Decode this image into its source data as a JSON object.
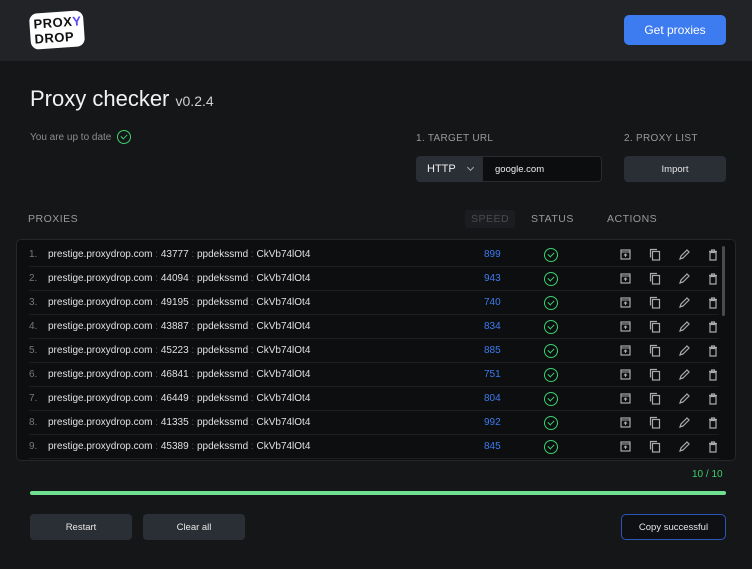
{
  "header": {
    "logo": "PROXY DROP",
    "get_proxies": "Get proxies"
  },
  "page": {
    "title": "Proxy checker",
    "version": "v0.2.4",
    "status": "You are up to date"
  },
  "target": {
    "label": "1. TARGET URL",
    "protocol": "HTTP",
    "url": "google.com"
  },
  "proxy_list": {
    "label": "2. PROXY LIST",
    "import": "Import"
  },
  "columns": {
    "proxies": "PROXIES",
    "speed": "SPEED",
    "status": "STATUS",
    "actions": "ACTIONS"
  },
  "rows": [
    {
      "n": "1.",
      "host": "prestige.proxydrop.com",
      "port": "43777",
      "user": "ppdekssmd",
      "pass": "CkVb74lOt4",
      "speed": "899",
      "ok": true
    },
    {
      "n": "2.",
      "host": "prestige.proxydrop.com",
      "port": "44094",
      "user": "ppdekssmd",
      "pass": "CkVb74lOt4",
      "speed": "943",
      "ok": true
    },
    {
      "n": "3.",
      "host": "prestige.proxydrop.com",
      "port": "49195",
      "user": "ppdekssmd",
      "pass": "CkVb74lOt4",
      "speed": "740",
      "ok": true
    },
    {
      "n": "4.",
      "host": "prestige.proxydrop.com",
      "port": "43887",
      "user": "ppdekssmd",
      "pass": "CkVb74lOt4",
      "speed": "834",
      "ok": true
    },
    {
      "n": "5.",
      "host": "prestige.proxydrop.com",
      "port": "45223",
      "user": "ppdekssmd",
      "pass": "CkVb74lOt4",
      "speed": "885",
      "ok": true
    },
    {
      "n": "6.",
      "host": "prestige.proxydrop.com",
      "port": "46841",
      "user": "ppdekssmd",
      "pass": "CkVb74lOt4",
      "speed": "751",
      "ok": true
    },
    {
      "n": "7.",
      "host": "prestige.proxydrop.com",
      "port": "46449",
      "user": "ppdekssmd",
      "pass": "CkVb74lOt4",
      "speed": "804",
      "ok": true
    },
    {
      "n": "8.",
      "host": "prestige.proxydrop.com",
      "port": "41335",
      "user": "ppdekssmd",
      "pass": "CkVb74lOt4",
      "speed": "992",
      "ok": true
    },
    {
      "n": "9.",
      "host": "prestige.proxydrop.com",
      "port": "45389",
      "user": "ppdekssmd",
      "pass": "CkVb74lOt4",
      "speed": "845",
      "ok": true
    }
  ],
  "progress": {
    "text": "10 / 10",
    "fraction": 1.0
  },
  "footer": {
    "restart": "Restart",
    "clear": "Clear all",
    "copy": "Copy successful"
  },
  "colors": {
    "accent": "#3d7bf0",
    "success": "#3ecf6e"
  }
}
